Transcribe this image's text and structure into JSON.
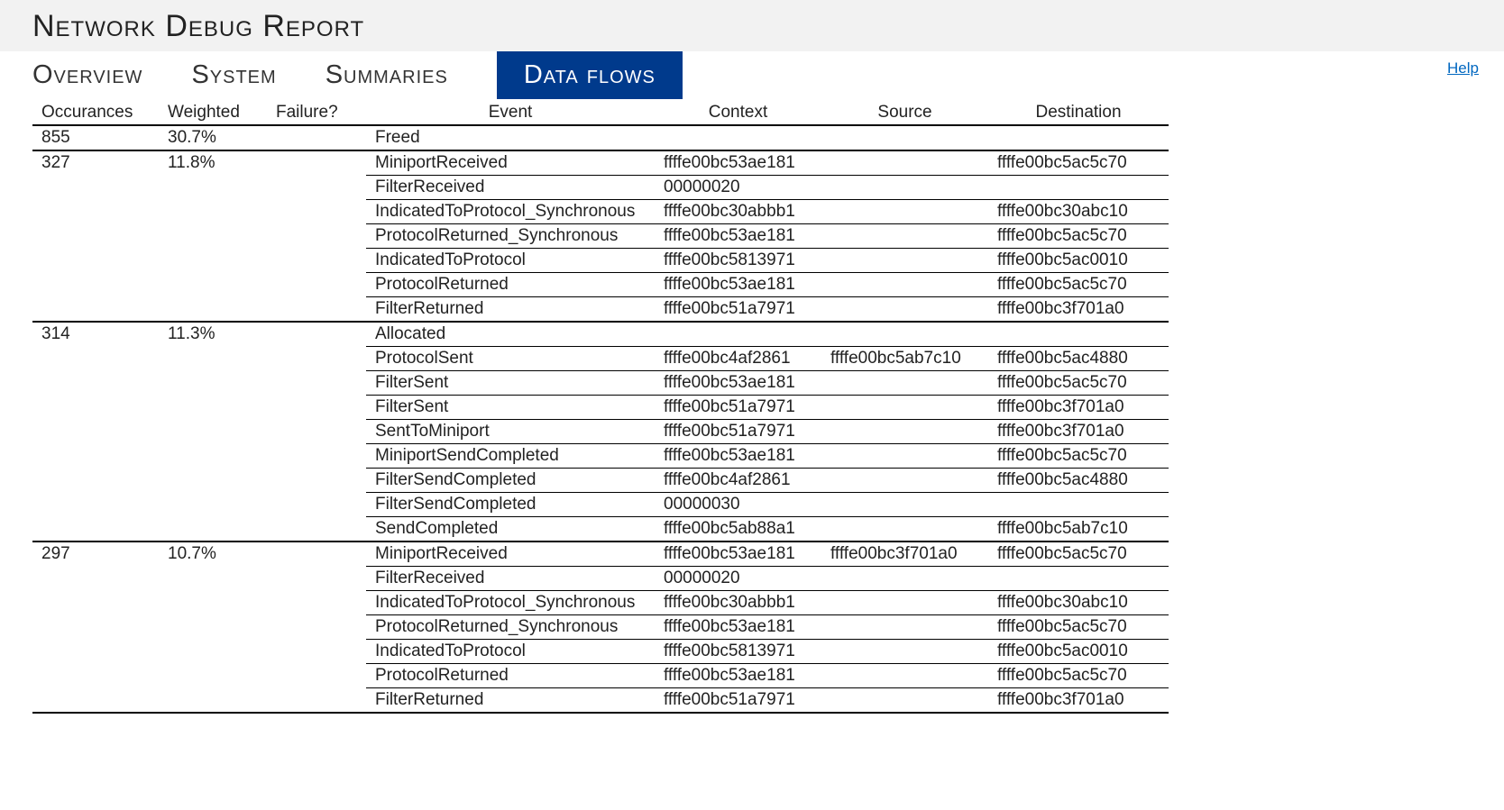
{
  "header": {
    "title": "Network Debug Report"
  },
  "help": {
    "label": "Help"
  },
  "tabs": [
    {
      "label": "Overview",
      "active": false
    },
    {
      "label": "System",
      "active": false
    },
    {
      "label": "Summaries",
      "active": false
    },
    {
      "label": "Data flows",
      "active": true
    }
  ],
  "table": {
    "columns": {
      "occurances": "Occurances",
      "weighted": "Weighted",
      "failure": "Failure?",
      "event": "Event",
      "context": "Context",
      "source": "Source",
      "destination": "Destination"
    },
    "groups": [
      {
        "occurances": "855",
        "weighted": "30.7%",
        "failure": "",
        "rows": [
          {
            "event": "Freed",
            "context": "",
            "source": "",
            "destination": ""
          }
        ]
      },
      {
        "occurances": "327",
        "weighted": "11.8%",
        "failure": "",
        "rows": [
          {
            "event": "MiniportReceived",
            "context": "ffffe00bc53ae181",
            "source": "",
            "destination": "ffffe00bc5ac5c70"
          },
          {
            "event": "FilterReceived",
            "context": "00000020",
            "source": "",
            "destination": ""
          },
          {
            "event": "IndicatedToProtocol_Synchronous",
            "context": "ffffe00bc30abbb1",
            "source": "",
            "destination": "ffffe00bc30abc10"
          },
          {
            "event": "ProtocolReturned_Synchronous",
            "context": "ffffe00bc53ae181",
            "source": "",
            "destination": "ffffe00bc5ac5c70"
          },
          {
            "event": "IndicatedToProtocol",
            "context": "ffffe00bc5813971",
            "source": "",
            "destination": "ffffe00bc5ac0010"
          },
          {
            "event": "ProtocolReturned",
            "context": "ffffe00bc53ae181",
            "source": "",
            "destination": "ffffe00bc5ac5c70"
          },
          {
            "event": "FilterReturned",
            "context": "ffffe00bc51a7971",
            "source": "",
            "destination": "ffffe00bc3f701a0"
          }
        ]
      },
      {
        "occurances": "314",
        "weighted": "11.3%",
        "failure": "",
        "rows": [
          {
            "event": "Allocated",
            "context": "",
            "source": "",
            "destination": ""
          },
          {
            "event": "ProtocolSent",
            "context": "ffffe00bc4af2861",
            "source": "ffffe00bc5ab7c10",
            "destination": "ffffe00bc5ac4880"
          },
          {
            "event": "FilterSent",
            "context": "ffffe00bc53ae181",
            "source": "",
            "destination": "ffffe00bc5ac5c70"
          },
          {
            "event": "FilterSent",
            "context": "ffffe00bc51a7971",
            "source": "",
            "destination": "ffffe00bc3f701a0"
          },
          {
            "event": "SentToMiniport",
            "context": "ffffe00bc51a7971",
            "source": "",
            "destination": "ffffe00bc3f701a0"
          },
          {
            "event": "MiniportSendCompleted",
            "context": "ffffe00bc53ae181",
            "source": "",
            "destination": "ffffe00bc5ac5c70"
          },
          {
            "event": "FilterSendCompleted",
            "context": "ffffe00bc4af2861",
            "source": "",
            "destination": "ffffe00bc5ac4880"
          },
          {
            "event": "FilterSendCompleted",
            "context": "00000030",
            "source": "",
            "destination": ""
          },
          {
            "event": "SendCompleted",
            "context": "ffffe00bc5ab88a1",
            "source": "",
            "destination": "ffffe00bc5ab7c10"
          }
        ]
      },
      {
        "occurances": "297",
        "weighted": "10.7%",
        "failure": "",
        "rows": [
          {
            "event": "MiniportReceived",
            "context": "ffffe00bc53ae181",
            "source": "ffffe00bc3f701a0",
            "destination": "ffffe00bc5ac5c70"
          },
          {
            "event": "FilterReceived",
            "context": "00000020",
            "source": "",
            "destination": ""
          },
          {
            "event": "IndicatedToProtocol_Synchronous",
            "context": "ffffe00bc30abbb1",
            "source": "",
            "destination": "ffffe00bc30abc10"
          },
          {
            "event": "ProtocolReturned_Synchronous",
            "context": "ffffe00bc53ae181",
            "source": "",
            "destination": "ffffe00bc5ac5c70"
          },
          {
            "event": "IndicatedToProtocol",
            "context": "ffffe00bc5813971",
            "source": "",
            "destination": "ffffe00bc5ac0010"
          },
          {
            "event": "ProtocolReturned",
            "context": "ffffe00bc53ae181",
            "source": "",
            "destination": "ffffe00bc5ac5c70"
          },
          {
            "event": "FilterReturned",
            "context": "ffffe00bc51a7971",
            "source": "",
            "destination": "ffffe00bc3f701a0"
          }
        ]
      }
    ]
  }
}
